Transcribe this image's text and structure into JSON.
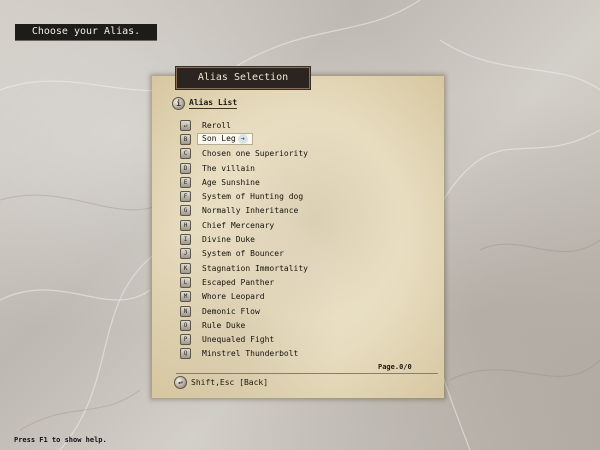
{
  "prompt": "Choose your Alias.",
  "panel": {
    "title": "Alias Selection",
    "list_header": "Alias List",
    "page": "Page.0/0",
    "footer": "Shift,Esc [Back]"
  },
  "aliases": [
    {
      "key": "↵",
      "label": "Reroll"
    },
    {
      "key": "B",
      "label": "Son Leg"
    },
    {
      "key": "C",
      "label": "Chosen one Superiority"
    },
    {
      "key": "D",
      "label": "The villain"
    },
    {
      "key": "E",
      "label": "Age Sunshine"
    },
    {
      "key": "F",
      "label": "System of Hunting dog"
    },
    {
      "key": "G",
      "label": "Normally Inheritance"
    },
    {
      "key": "H",
      "label": "Chief Mercenary"
    },
    {
      "key": "I",
      "label": "Divine Duke"
    },
    {
      "key": "J",
      "label": "System of Bouncer"
    },
    {
      "key": "K",
      "label": "Stagnation Immortality"
    },
    {
      "key": "L",
      "label": "Escaped Panther"
    },
    {
      "key": "M",
      "label": "Whore Leopard"
    },
    {
      "key": "N",
      "label": "Demonic Flow"
    },
    {
      "key": "O",
      "label": "Rule Duke"
    },
    {
      "key": "P",
      "label": "Unequaled Fight"
    },
    {
      "key": "Q",
      "label": "Minstrel Thunderbolt"
    }
  ],
  "selected_index": 1,
  "help": "Press F1 to show help."
}
